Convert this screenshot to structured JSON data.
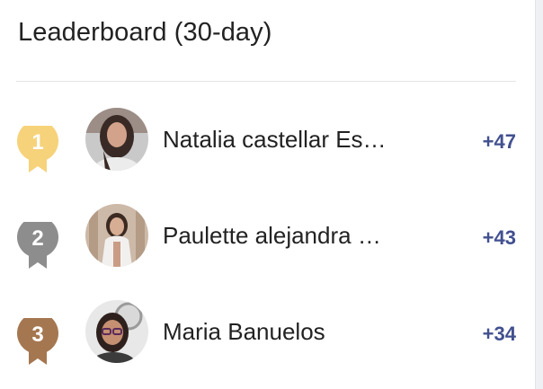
{
  "leaderboard": {
    "title": "Leaderboard (30-day)",
    "entries": [
      {
        "rank": "1",
        "name": "Natalia castellar Es…",
        "score": "+47",
        "medal_color": "#f6d27a"
      },
      {
        "rank": "2",
        "name": "Paulette alejandra …",
        "score": "+43",
        "medal_color": "#8d8d8d"
      },
      {
        "rank": "3",
        "name": "Maria Banuelos",
        "score": "+34",
        "medal_color": "#a57750"
      }
    ]
  },
  "colors": {
    "score": "#42508f",
    "divider": "#e6e6e6"
  }
}
